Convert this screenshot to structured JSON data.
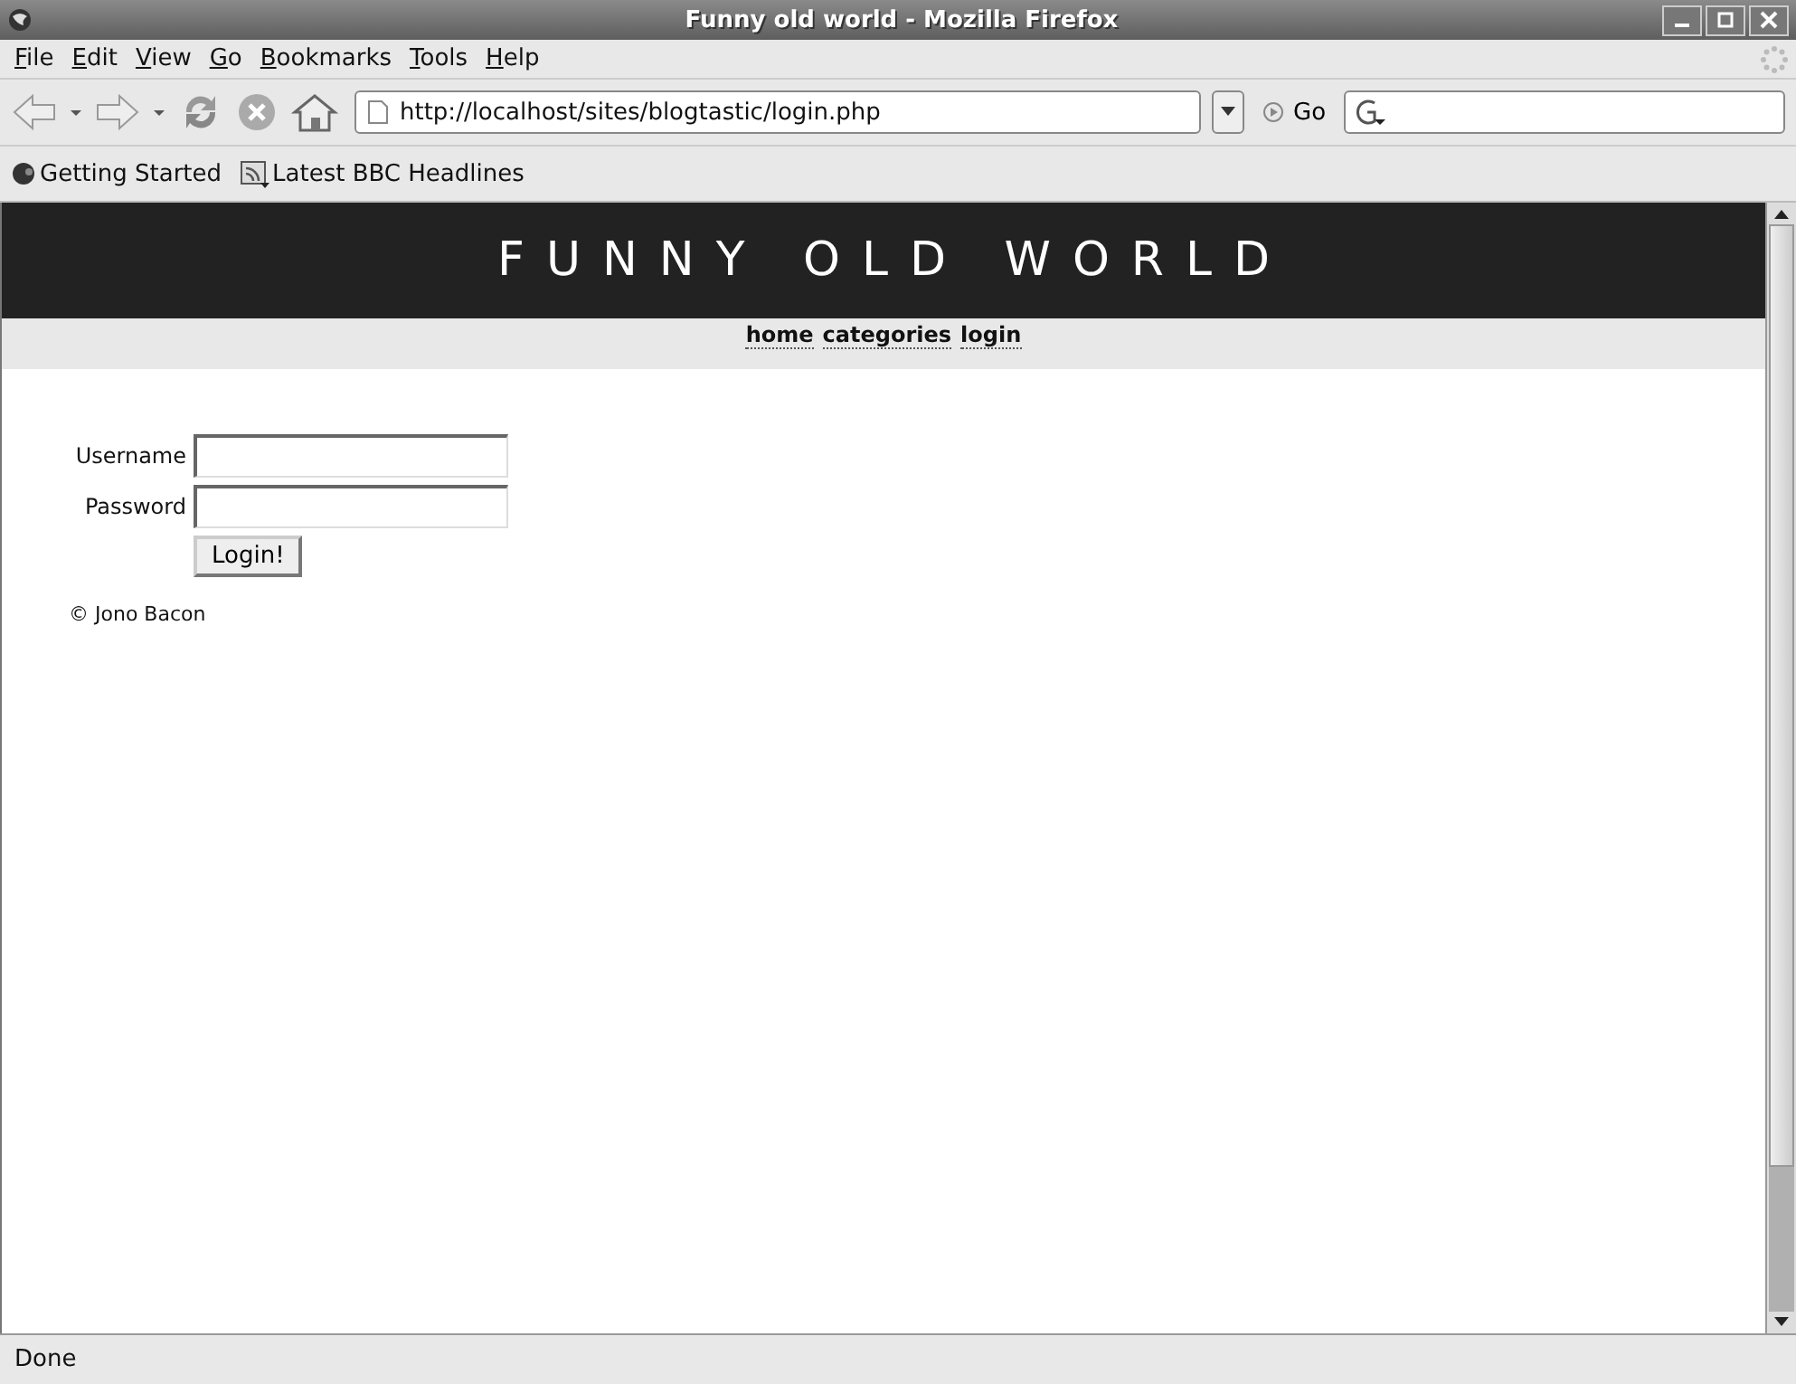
{
  "window": {
    "title": "Funny old world - Mozilla Firefox"
  },
  "menu": [
    "File",
    "Edit",
    "View",
    "Go",
    "Bookmarks",
    "Tools",
    "Help"
  ],
  "toolbar": {
    "url": "http://localhost/sites/blogtastic/login.php",
    "go_label": "Go"
  },
  "bookmarks": [
    {
      "label": "Getting Started",
      "kind": "page"
    },
    {
      "label": "Latest BBC Headlines",
      "kind": "feed"
    }
  ],
  "page": {
    "site_title": "FUNNY OLD WORLD",
    "nav": [
      "home",
      "categories",
      "login"
    ],
    "form": {
      "fields": [
        {
          "label": "Username"
        },
        {
          "label": "Password"
        }
      ],
      "submit": "Login!"
    },
    "footer": "© Jono Bacon"
  },
  "status_bar": "Done"
}
